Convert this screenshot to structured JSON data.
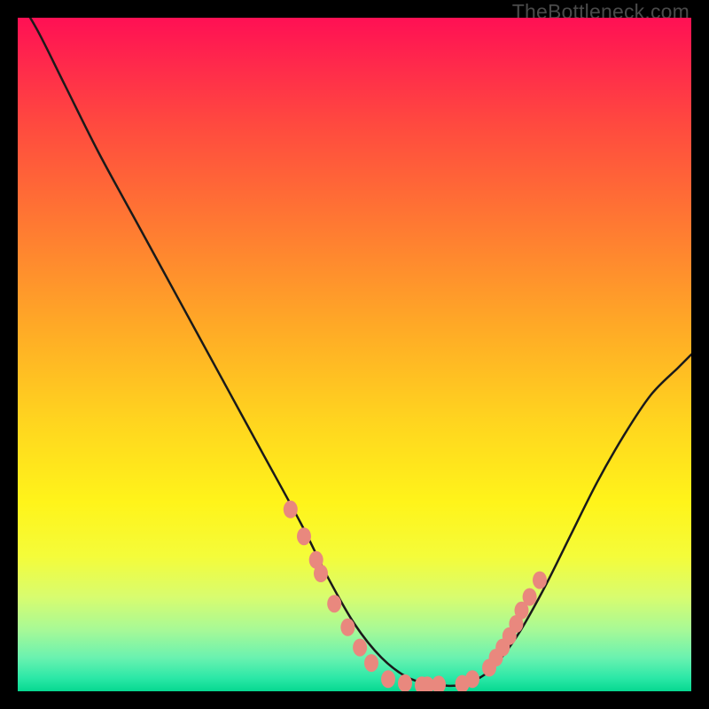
{
  "watermark": "TheBottleneck.com",
  "colors": {
    "curve_stroke": "#1a1a1a",
    "marker_fill": "#e9887e",
    "marker_stroke": "#d66a60"
  },
  "chart_data": {
    "type": "line",
    "title": "",
    "xlabel": "",
    "ylabel": "",
    "xlim": [
      0,
      100
    ],
    "ylim": [
      0,
      100
    ],
    "curve": {
      "x": [
        0,
        3,
        7,
        12,
        18,
        24,
        30,
        36,
        42,
        46,
        50,
        54,
        58,
        62,
        66,
        70,
        74,
        78,
        82,
        86,
        90,
        94,
        98,
        100
      ],
      "y": [
        103,
        98,
        90,
        80,
        69,
        58,
        47,
        36,
        25,
        17,
        10,
        5,
        2,
        1,
        1,
        3,
        8,
        15,
        23,
        31,
        38,
        44,
        48,
        50
      ]
    },
    "markers_left": {
      "x": [
        40.5,
        42.5,
        44.3,
        45.0,
        47.0,
        49.0,
        50.8,
        52.5
      ],
      "y": [
        27.0,
        23.0,
        19.5,
        17.5,
        13.0,
        9.5,
        6.5,
        4.2
      ]
    },
    "markers_bottom": {
      "x": [
        55.0,
        57.5,
        60.0,
        60.8,
        62.5,
        66.0,
        67.5
      ],
      "y": [
        1.8,
        1.2,
        0.9,
        0.9,
        1.0,
        1.1,
        1.8
      ]
    },
    "markers_right": {
      "x": [
        70.0,
        71.0,
        72.0,
        73.0,
        74.0,
        74.8,
        76.0,
        77.5
      ],
      "y": [
        3.5,
        5.0,
        6.5,
        8.2,
        10.0,
        12.0,
        14.0,
        16.5
      ]
    }
  }
}
